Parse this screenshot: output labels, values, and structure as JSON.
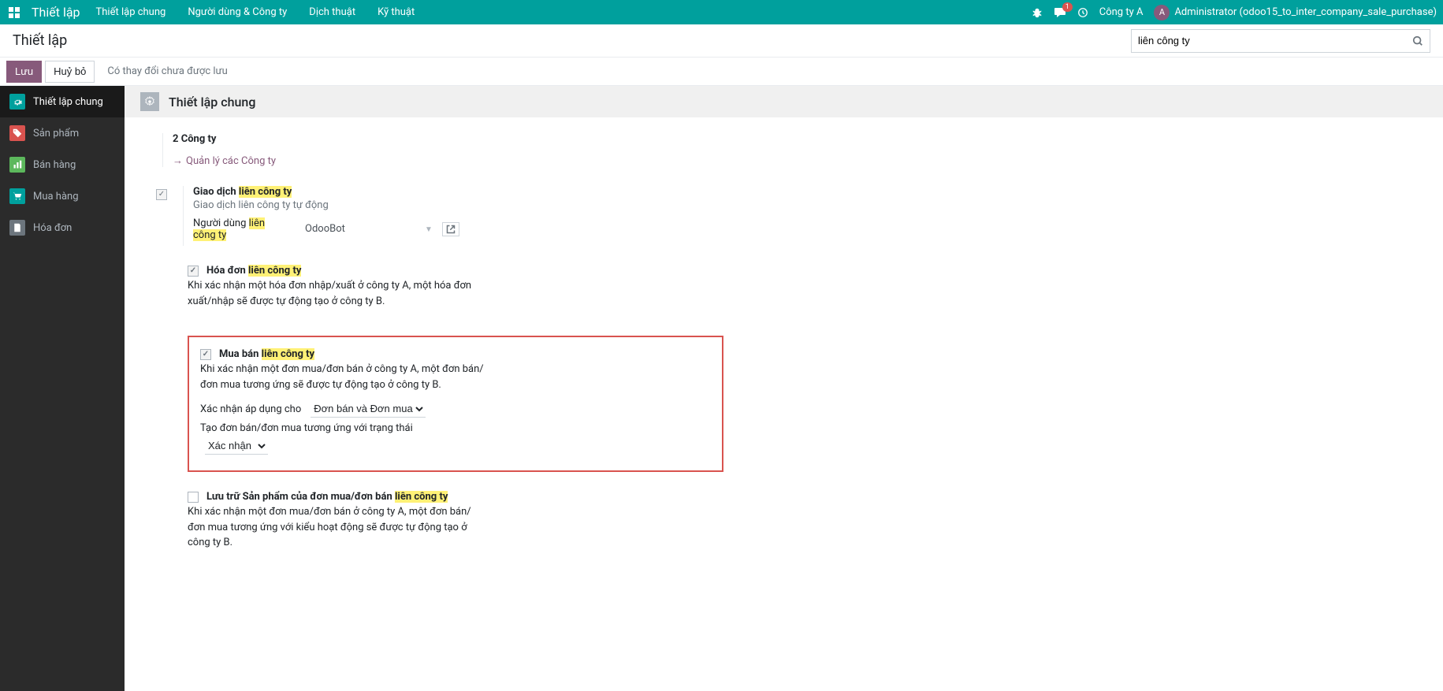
{
  "navbar": {
    "title": "Thiết lập",
    "menu": [
      "Thiết lập chung",
      "Người dùng & Công ty",
      "Dịch thuật",
      "Kỹ thuật"
    ],
    "company": "Công ty A",
    "user": "Administrator (odoo15_to_inter_company_sale_purchase)",
    "avatar_letter": "A",
    "badge_count": "1"
  },
  "breadcrumb": {
    "title": "Thiết lập"
  },
  "search": {
    "value": "liên công ty"
  },
  "actions": {
    "save": "Lưu",
    "cancel": "Huỷ bỏ",
    "status": "Có thay đổi chưa được lưu"
  },
  "sidebar": {
    "items": [
      {
        "label": "Thiết lập chung",
        "icon_class": "icon-teal"
      },
      {
        "label": "Sản phẩm",
        "icon_class": "icon-red"
      },
      {
        "label": "Bán hàng",
        "icon_class": "icon-green"
      },
      {
        "label": "Mua hàng",
        "icon_class": "icon-teal"
      },
      {
        "label": "Hóa đơn",
        "icon_class": "icon-gray"
      }
    ]
  },
  "section": {
    "title": "Thiết lập chung"
  },
  "companies": {
    "count": "2 Công ty",
    "link": "Quản lý các Công ty"
  },
  "intercompany": {
    "label_pre": "Giao dịch ",
    "label_hl": "liên công ty",
    "desc": "Giao dịch liên công ty tự động",
    "user_label_pre": "Người dùng ",
    "user_label_hl1": "liên",
    "user_label_hl2": "công ty",
    "user_value": "OdooBot"
  },
  "invoice": {
    "label_pre": "Hóa đơn ",
    "label_hl": "liên công ty",
    "desc": "Khi xác nhận một hóa đơn nhập/xuất ở công ty A, một hóa đơn xuất/nhập sẽ được tự động tạo ở công ty B."
  },
  "sale_purchase": {
    "label_pre": "Mua bán ",
    "label_hl": "liên công ty",
    "desc": "Khi xác nhận một đơn mua/đơn bán ở công ty A, một đơn bán/đơn mua tương ứng sẽ được tự động tạo ở công ty B.",
    "apply_label": "Xác nhận áp dụng cho",
    "apply_value": "Đơn bán và Đơn mua",
    "state_label": "Tạo đơn bán/đơn mua tương ứng với trạng thái",
    "state_value": "Xác nhận"
  },
  "warehouse": {
    "label_pre": "Lưu trữ Sản phẩm của đơn mua/đơn bán ",
    "label_hl": "liên công ty",
    "desc": "Khi xác nhận một đơn mua/đơn bán ở công ty A, một đơn bán/đơn mua tương ứng với kiểu hoạt động sẽ được tự động tạo ở công ty B."
  }
}
